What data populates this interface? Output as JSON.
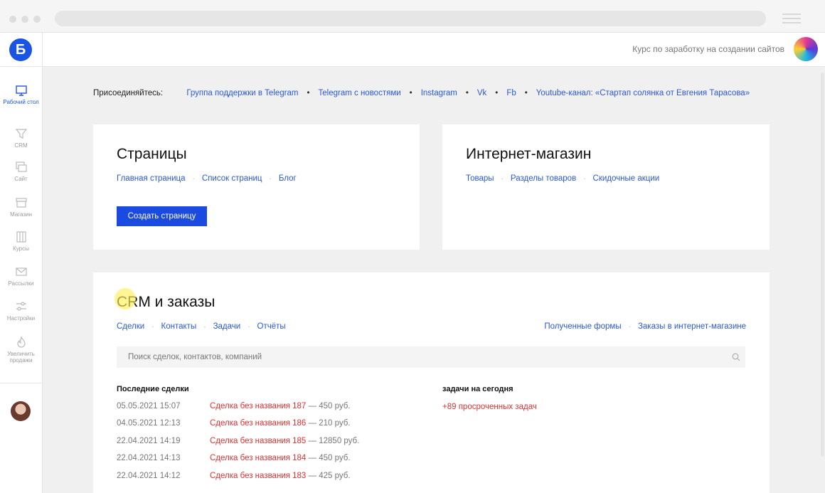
{
  "sidebar": {
    "logo": "Б",
    "items": [
      {
        "label": "Рабочий стол",
        "icon": "monitor-icon"
      },
      {
        "label": "CRM",
        "icon": "funnel-icon"
      },
      {
        "label": "Сайт",
        "icon": "site-icon"
      },
      {
        "label": "Магазин",
        "icon": "shop-icon"
      },
      {
        "label": "Курсы",
        "icon": "courses-icon"
      },
      {
        "label": "Рассылки",
        "icon": "mail-icon"
      },
      {
        "label": "Настройки",
        "icon": "sliders-icon"
      },
      {
        "label": "Увеличить продажи",
        "icon": "flame-icon"
      }
    ]
  },
  "header": {
    "course_text": "Курс по заработку на создании сайтов"
  },
  "join": {
    "label": "Присоединяйтесь:",
    "links": [
      "Группа поддержки в Telegram",
      "Telegram с новостями",
      "Instagram",
      "Vk",
      "Fb",
      "Youtube-канал: «Стартап солянка от Евгения Тарасова»"
    ],
    "separator": "•"
  },
  "pages": {
    "title": "Страницы",
    "links": [
      "Главная страница",
      "Список страниц",
      "Блог"
    ],
    "create_button": "Создать страницу"
  },
  "shop": {
    "title": "Интернет-магазин",
    "links": [
      "Товары",
      "Разделы товаров",
      "Скидочные акции"
    ]
  },
  "crm": {
    "title": "CRM и заказы",
    "links_left": [
      "Сделки",
      "Контакты",
      "Задачи",
      "Отчёты"
    ],
    "links_right": [
      "Полученные формы",
      "Заказы в интернет-магазине"
    ],
    "search_placeholder": "Поиск сделок, контактов, компаний",
    "recent_deals_title": "Последние сделки",
    "tasks_title": "задачи на сегодня",
    "overdue": "+89 просроченных задач",
    "deals": [
      {
        "date": "05.05.2021 15:07",
        "name": "Сделка без названия 187",
        "amount": " — 450 руб."
      },
      {
        "date": "04.05.2021 12:13",
        "name": "Сделка без названия 186",
        "amount": " — 210 руб."
      },
      {
        "date": "22.04.2021 14:19",
        "name": "Сделка без названия 185",
        "amount": " — 12850 руб."
      },
      {
        "date": "22.04.2021 14:13",
        "name": "Сделка без названия 184",
        "amount": " — 450 руб."
      },
      {
        "date": "22.04.2021 14:12",
        "name": "Сделка без названия 183",
        "amount": " — 425 руб."
      }
    ]
  },
  "colors": {
    "accent": "#1a4ae0",
    "link": "#2a58d8",
    "deal_red": "#e03030"
  }
}
